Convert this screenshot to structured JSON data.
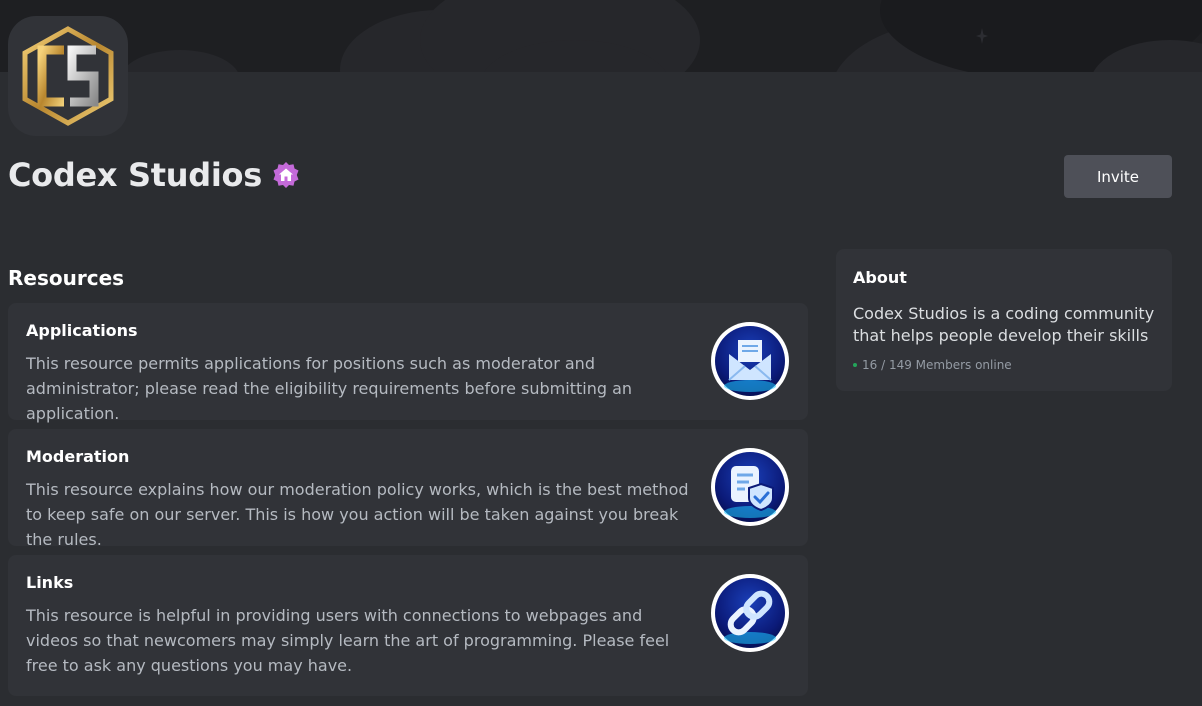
{
  "server": {
    "name": "Codex Studios",
    "logo_letters": "CS",
    "invite_label": "Invite"
  },
  "resources": {
    "heading": "Resources",
    "items": [
      {
        "title": "Applications",
        "description": "This resource permits applications for positions such as moderator and administrator; please read the eligibility requirements before submitting an application.",
        "icon": "envelope-icon"
      },
      {
        "title": "Moderation",
        "description": "This resource explains how our moderation policy works, which is the best method to keep safe on our server. This is how you action will be taken against you break the rules.",
        "icon": "shield-document-icon"
      },
      {
        "title": "Links",
        "description": "This resource is helpful in providing users with connections to webpages and videos so that newcomers may simply learn the art of programming. Please feel free to ask any questions you may have.",
        "icon": "link-icon"
      }
    ]
  },
  "about": {
    "title": "About",
    "text": "Codex Studios is a coding community that helps people develop their skills",
    "online_count": "16 / 149 Members online"
  },
  "colors": {
    "background": "#2b2d31",
    "card": "#313338",
    "button": "#4e5058",
    "online": "#23a55a",
    "badge": "#c46ad9",
    "logo_gold": "#d4a94a"
  }
}
